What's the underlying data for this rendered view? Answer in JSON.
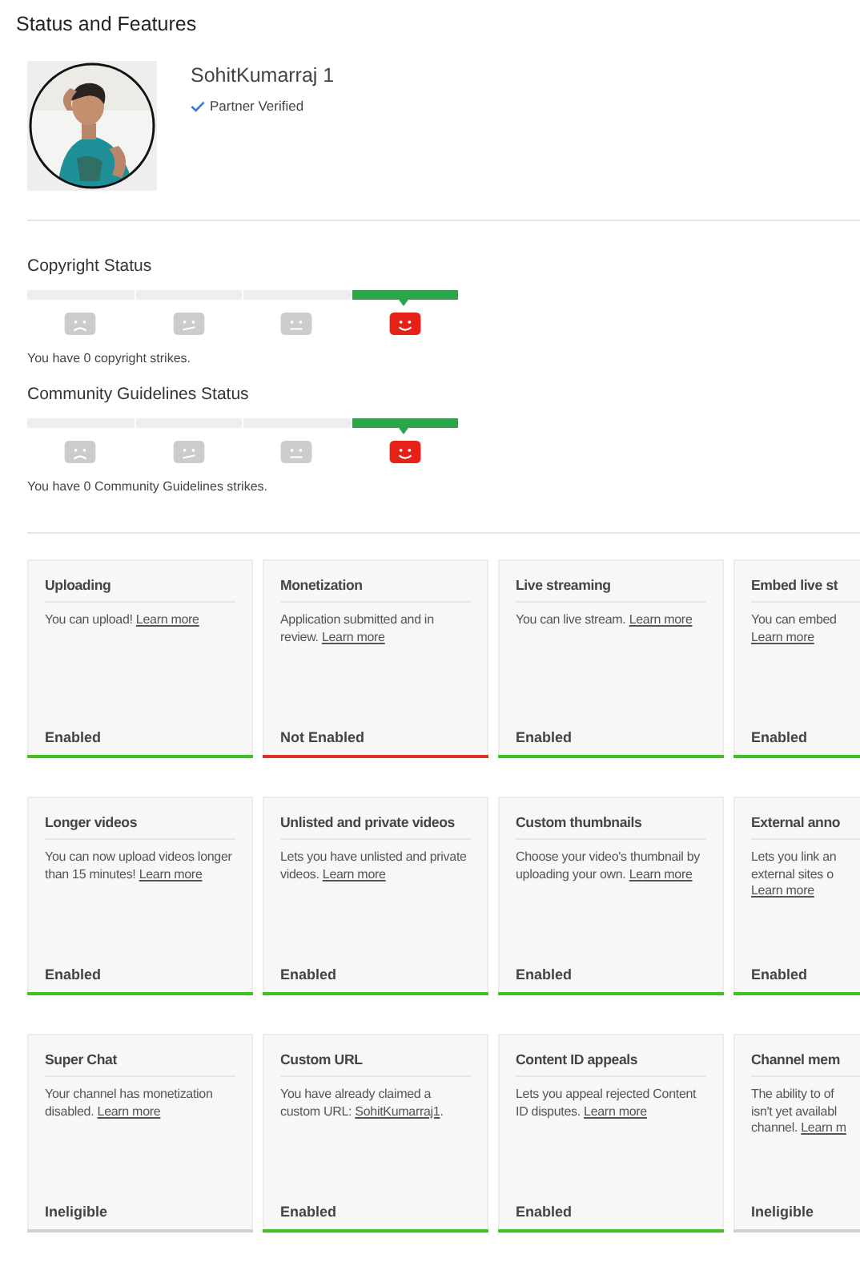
{
  "page_title": "Status and Features",
  "channel": {
    "name": "SohitKumarraj 1",
    "badge": "Partner Verified"
  },
  "meters": [
    {
      "title": "Copyright Status",
      "levels": [
        {
          "kind": "sad",
          "selected": false
        },
        {
          "kind": "wry",
          "selected": false
        },
        {
          "kind": "neutral",
          "selected": false
        },
        {
          "kind": "happy",
          "selected": true
        }
      ],
      "note": "You have 0 copyright strikes."
    },
    {
      "title": "Community Guidelines Status",
      "levels": [
        {
          "kind": "sad",
          "selected": false
        },
        {
          "kind": "wry",
          "selected": false
        },
        {
          "kind": "neutral",
          "selected": false
        },
        {
          "kind": "happy",
          "selected": true
        }
      ],
      "note": "You have 0 Community Guidelines strikes."
    }
  ],
  "features": [
    {
      "title": "Uploading",
      "description": [
        {
          "kind": "text",
          "text": "You can upload!"
        },
        {
          "kind": "link",
          "text": "Learn more"
        }
      ],
      "status": "Enabled",
      "color": "#3ec31e"
    },
    {
      "title": "Monetization",
      "description": [
        {
          "kind": "text",
          "text": "Application submitted and in review."
        },
        {
          "kind": "link",
          "text": "Learn more"
        }
      ],
      "status": "Not Enabled",
      "color": "#e52d27"
    },
    {
      "title": "Live streaming",
      "description": [
        {
          "kind": "text",
          "text": "You can live stream."
        },
        {
          "kind": "link",
          "text": "Learn more"
        }
      ],
      "status": "Enabled",
      "color": "#3ec31e"
    },
    {
      "title": "Embed live st",
      "lines": [
        [
          {
            "kind": "text",
            "text": "You can embed"
          }
        ],
        [
          {
            "kind": "link",
            "text": "Learn more"
          }
        ]
      ],
      "status": "Enabled",
      "color": "#3ec31e"
    },
    {
      "title": "Longer videos",
      "description": [
        {
          "kind": "text",
          "text": "You can now upload videos longer than 15 minutes!"
        },
        {
          "kind": "link",
          "text": "Learn more"
        }
      ],
      "status": "Enabled",
      "color": "#3ec31e"
    },
    {
      "title": "Unlisted and private videos",
      "description": [
        {
          "kind": "text",
          "text": "Lets you have unlisted and private videos."
        },
        {
          "kind": "link",
          "text": "Learn more"
        }
      ],
      "status": "Enabled",
      "color": "#3ec31e"
    },
    {
      "title": "Custom thumbnails",
      "description": [
        {
          "kind": "text",
          "text": "Choose your video's thumbnail by uploading your own."
        },
        {
          "kind": "link",
          "text": "Learn more"
        }
      ],
      "status": "Enabled",
      "color": "#3ec31e"
    },
    {
      "title": "External anno",
      "lines": [
        [
          {
            "kind": "text",
            "text": "Lets you link an"
          }
        ],
        [
          {
            "kind": "text",
            "text": "external sites o"
          }
        ],
        [
          {
            "kind": "link",
            "text": "Learn more"
          }
        ]
      ],
      "status": "Enabled",
      "color": "#3ec31e"
    },
    {
      "title": "Super Chat",
      "description": [
        {
          "kind": "text",
          "text": "Your channel has monetization disabled."
        },
        {
          "kind": "link",
          "text": "Learn more"
        }
      ],
      "status": "Ineligible",
      "color": "#d0d0d0"
    },
    {
      "title": "Custom URL",
      "description": [
        {
          "kind": "text",
          "text": "You have already claimed a custom URL:"
        },
        {
          "kind": "link",
          "text": "SohitKumarraj1"
        },
        {
          "kind": "text",
          "text": "."
        }
      ],
      "status": "Enabled",
      "color": "#3ec31e"
    },
    {
      "title": "Content ID appeals",
      "description": [
        {
          "kind": "text",
          "text": "Lets you appeal rejected Content ID disputes."
        },
        {
          "kind": "link",
          "text": "Learn more"
        }
      ],
      "status": "Enabled",
      "color": "#3ec31e"
    },
    {
      "title": "Channel mem",
      "lines": [
        [
          {
            "kind": "text",
            "text": "The ability to of"
          }
        ],
        [
          {
            "kind": "text",
            "text": "isn't yet availabl"
          }
        ],
        [
          {
            "kind": "text",
            "text": "channel."
          },
          {
            "kind": "link",
            "text": "Learn m"
          }
        ]
      ],
      "status": "Ineligible",
      "color": "#d0d0d0"
    }
  ]
}
